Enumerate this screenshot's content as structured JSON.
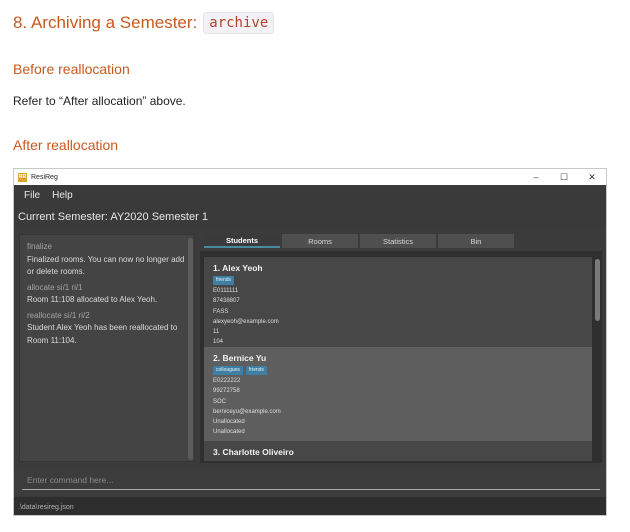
{
  "doc": {
    "section_title": "8. Archiving a Semester:",
    "section_code": "archive",
    "before_heading": "Before reallocation",
    "before_text": "Refer to “After allocation” above.",
    "after_heading": "After reallocation"
  },
  "window": {
    "title": "ResiReg",
    "icon_label": "RR",
    "controls": {
      "minimize": "–",
      "maximize": "☐",
      "close": "✕"
    }
  },
  "menu": {
    "file": "File",
    "help": "Help"
  },
  "semester_label": "Current Semester: AY2020 Semester 1",
  "result": [
    {
      "cmd": "finalize",
      "msg": "Finalized rooms. You can now no longer add or delete rooms."
    },
    {
      "cmd": "allocate si/1 ri/1",
      "msg": "Room 11:108 allocated to Alex Yeoh."
    },
    {
      "cmd": "reallocate si/1 ri/2",
      "msg": "Student Alex Yeoh has been reallocated to Room 11:104."
    }
  ],
  "tabs": [
    "Students",
    "Rooms",
    "Statistics",
    "Bin"
  ],
  "students": [
    {
      "name": "1.  Alex Yeoh",
      "tags": [
        "friends"
      ],
      "id": "E0111111",
      "phone": "87438807",
      "faculty": "FASS",
      "email": "alexyeoh@example.com",
      "floor": "11",
      "room": "104"
    },
    {
      "name": "2.  Bernice Yu",
      "tags": [
        "colleagues",
        "friends"
      ],
      "id": "E0222222",
      "phone": "99272758",
      "faculty": "SOC",
      "email": "berniceyu@example.com",
      "floor": "Unallocated",
      "room": "Unallocated"
    },
    {
      "name": "3.  Charlotte Oliveiro"
    }
  ],
  "command_placeholder": "Enter command here...",
  "status_path": ".\\data\\resireg.json"
}
